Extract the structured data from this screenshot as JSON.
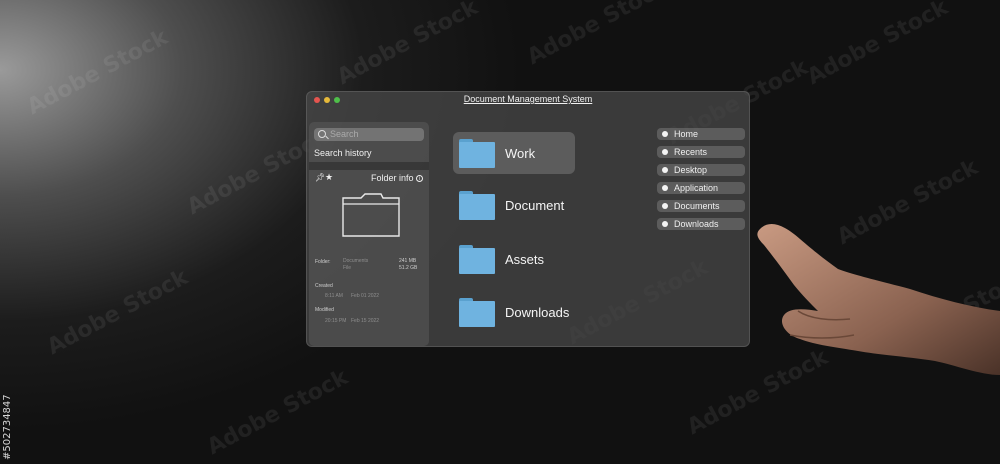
{
  "watermark": "Adobe Stock",
  "stock_id": "#502734847",
  "window": {
    "title": "Document Management System"
  },
  "left_panel": {
    "search_placeholder": "Search",
    "search_history": "Search history",
    "folder_info": "Folder info",
    "folder_label": "Folder:",
    "folder_name": "Documents",
    "folder_type": "File",
    "size_1": "241 MB",
    "size_2": "51.2 GB",
    "created_label": "Created",
    "created_time": "8:11 AM",
    "created_date": "Feb 01 2022",
    "modified_label": "Modified",
    "modified_time": "20:15 PM",
    "modified_date": "Feb 15 2022"
  },
  "folders": [
    "Work",
    "Document",
    "Assets",
    "Downloads"
  ],
  "nav": [
    "Home",
    "Recents",
    "Desktop",
    "Application",
    "Documents",
    "Downloads"
  ],
  "colors": {
    "folder": "#6fb3e0",
    "window_bg": "#464646",
    "dot_red": "#e5554f",
    "dot_yellow": "#e6b93a",
    "dot_green": "#4fbf4a"
  }
}
